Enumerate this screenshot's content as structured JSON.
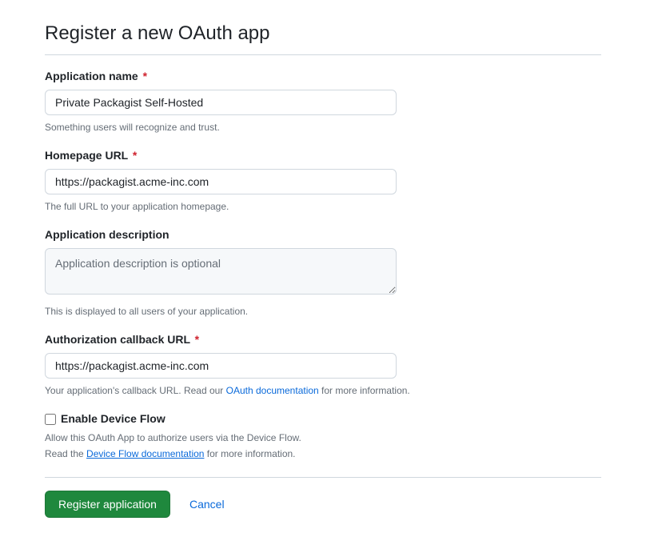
{
  "page_title": "Register a new OAuth app",
  "fields": {
    "app_name": {
      "label": "Application name",
      "value": "Private Packagist Self-Hosted",
      "note": "Something users will recognize and trust."
    },
    "homepage_url": {
      "label": "Homepage URL",
      "value": "https://packagist.acme-inc.com",
      "note": "The full URL to your application homepage."
    },
    "app_description": {
      "label": "Application description",
      "placeholder": "Application description is optional",
      "note": "This is displayed to all users of your application."
    },
    "callback_url": {
      "label": "Authorization callback URL",
      "value": "https://packagist.acme-inc.com",
      "note_before": "Your application's callback URL. Read our ",
      "note_link": "OAuth documentation",
      "note_after": " for more information."
    },
    "device_flow": {
      "label": "Enable Device Flow",
      "note_line1": "Allow this OAuth App to authorize users via the Device Flow.",
      "note_before": "Read the ",
      "note_link": "Device Flow documentation",
      "note_after": " for more information."
    }
  },
  "actions": {
    "submit": "Register application",
    "cancel": "Cancel"
  },
  "required_marker": "*"
}
